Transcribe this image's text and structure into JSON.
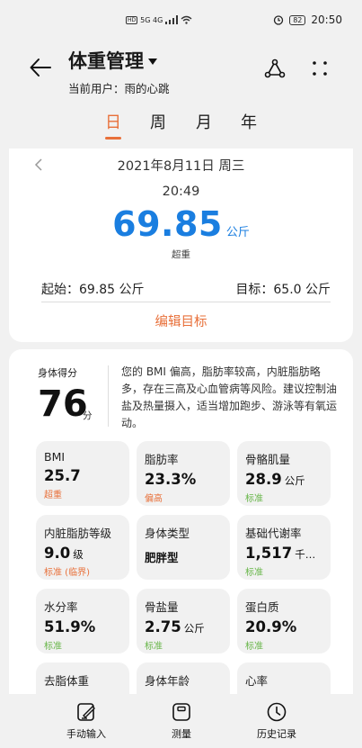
{
  "status": {
    "network": "5G 4G",
    "battery": "82",
    "time": "20:50"
  },
  "header": {
    "title": "体重管理",
    "subtitle": "当前用户：雨的心跳"
  },
  "tabs": [
    "日",
    "周",
    "月",
    "年"
  ],
  "summary": {
    "date": "2021年8月11日 周三",
    "time": "20:49",
    "weight": "69.85",
    "unit": "公斤",
    "status": "超重",
    "start": "起始：69.85 公斤",
    "goal": "目标：65.0 公斤",
    "edit_goal": "编辑目标"
  },
  "score": {
    "label": "身体得分",
    "value": "76",
    "unit": "分",
    "advice": "您的 BMI 偏高，脂肪率较高，内脏脂肪略多，存在三高及心血管病等风险。建议控制油盐及热量摄入，适当增加跑步、游泳等有氧运动。"
  },
  "metrics": [
    {
      "label": "BMI",
      "value": "25.7",
      "unit": "",
      "status": "超重",
      "tone": "red"
    },
    {
      "label": "脂肪率",
      "value": "23.3%",
      "unit": "",
      "status": "偏高",
      "tone": "red"
    },
    {
      "label": "骨骼肌量",
      "value": "28.9",
      "unit": "公斤",
      "status": "标准",
      "tone": "green"
    },
    {
      "label": "内脏脂肪等级",
      "value": "9.0",
      "unit": "级",
      "status": "标准 (临界)",
      "tone": "green"
    },
    {
      "label": "身体类型",
      "value": "肥胖型",
      "unit": "",
      "status": "",
      "tone": "small"
    },
    {
      "label": "基础代谢率",
      "value": "1,517",
      "unit": "千…",
      "status": "标准",
      "tone": "green"
    },
    {
      "label": "水分率",
      "value": "51.9%",
      "unit": "",
      "status": "标准",
      "tone": "green"
    },
    {
      "label": "骨盐量",
      "value": "2.75",
      "unit": "公斤",
      "status": "标准",
      "tone": "green"
    },
    {
      "label": "蛋白质",
      "value": "20.9%",
      "unit": "",
      "status": "标准",
      "tone": "green"
    },
    {
      "label": "去脂体重",
      "value": "",
      "unit": "",
      "status": "",
      "tone": "green"
    },
    {
      "label": "身体年龄",
      "value": "",
      "unit": "",
      "status": "",
      "tone": "green"
    },
    {
      "label": "心率",
      "value": "",
      "unit": "",
      "status": "",
      "tone": "green"
    }
  ],
  "bottom_nav": [
    {
      "label": "手动输入",
      "icon": "edit-icon"
    },
    {
      "label": "测量",
      "icon": "scale-icon"
    },
    {
      "label": "历史记录",
      "icon": "clock-icon"
    }
  ],
  "colors": {
    "accent": "#e8703a",
    "weight": "#1a7ee0",
    "normal": "#66b547"
  }
}
